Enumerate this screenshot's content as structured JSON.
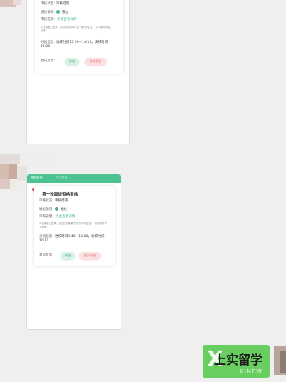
{
  "colors": {
    "accent_green": "#4cc38e",
    "check_green": "#45b97e",
    "reject_red": "#e07a7a",
    "dot_red": "#e34a4a"
  },
  "card_top": {
    "status_key": "审核状态:",
    "status_val": "审核结束",
    "pass_key": "通过情况:",
    "pass_val": "通过",
    "desc_key": "审核说明:",
    "desc_link": "点此查看详情",
    "note": "1.在电脑上登录，点击在侧菜单栏的“就时学生证”，打印就时学生证等。",
    "group_key": "分组信息:",
    "group_val": "进校时间13:50—14/10。离校时间15:20",
    "feedback_key": "意向反馈:",
    "join_btn": "参加",
    "decline_btn": "放弃参加"
  },
  "card_bottom": {
    "tab_1": "审核结果",
    "tab_2": "个人信息",
    "title": "第一轮面谈资格审核",
    "status_key": "审核状态:",
    "status_val": "审核结束",
    "pass_key": "通过情况:",
    "pass_val": "通过",
    "desc_key": "审核说明:",
    "desc_link": "点此查看详情",
    "note": "1.在电脑上登录，点击在侧菜单栏的“就时学生证”，打印就时学生证等。",
    "group_key": "分组信息:",
    "group_val": "进校时间9:40—10:00，离校时间10:10",
    "feedback_key": "意向反馈:",
    "join_btn": "参加",
    "decline_btn": "放弃参加"
  },
  "watermark": {
    "icon": "x-logo",
    "text": "上实留学",
    "sub": "X-NEW"
  }
}
